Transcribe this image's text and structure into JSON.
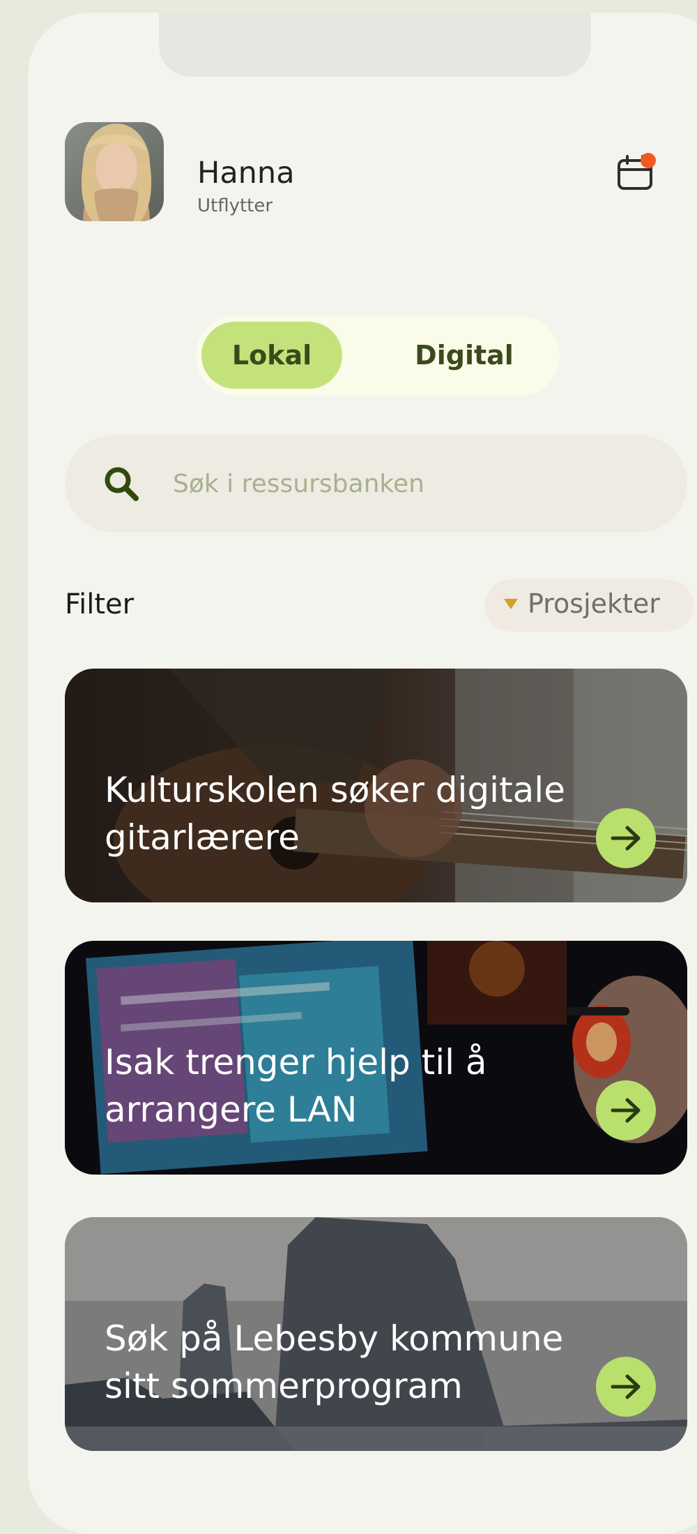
{
  "profile": {
    "name": "Hanna",
    "role": "Utflytter"
  },
  "mode_toggle": {
    "options": [
      "Lokal",
      "Digital"
    ],
    "selected": "Lokal"
  },
  "search": {
    "placeholder": "Søk i ressursbanken",
    "value": ""
  },
  "filter": {
    "label": "Filter",
    "selected": "Prosjekter"
  },
  "cards": [
    {
      "title": "Kulturskolen søker digitale gitarlærere"
    },
    {
      "title": "Isak trenger hjelp til å arrangere LAN"
    },
    {
      "title": "Søk på Lebesby kommune sitt sommerprogram"
    }
  ],
  "icons": {
    "calendar": "calendar-icon",
    "search": "search-icon",
    "arrow": "arrow-right-icon",
    "caret": "caret-down-icon"
  },
  "colors": {
    "accent_green": "#c4e27c",
    "arrow_green": "#b9e06c",
    "notification_dot": "#f05a22",
    "caret_gold": "#d2a02a",
    "dark_green": "#2f4a0e"
  }
}
